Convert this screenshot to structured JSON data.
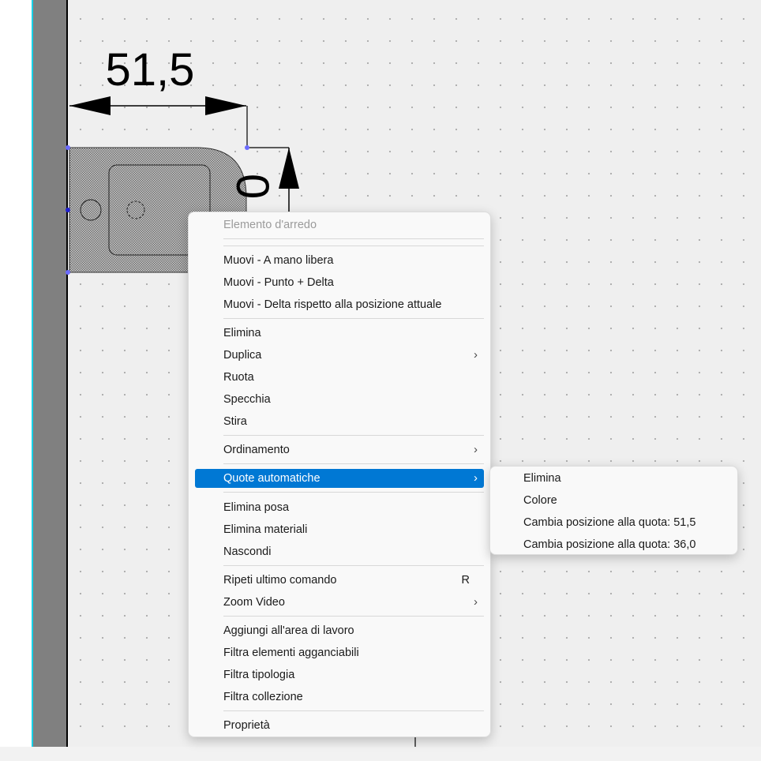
{
  "drawing": {
    "dimension_horizontal": "51,5",
    "dimension_vertical": "0"
  },
  "context_menu": {
    "header": "Elemento d'arredo",
    "items": [
      "Muovi - A mano libera",
      "Muovi - Punto + Delta",
      "Muovi - Delta rispetto alla posizione attuale",
      "Elimina",
      "Duplica",
      "Ruota",
      "Specchia",
      "Stira",
      "Ordinamento",
      "Quote automatiche",
      "Elimina posa",
      "Elimina materiali",
      "Nascondi",
      "Ripeti ultimo comando",
      "Zoom Video",
      "Aggiungi all'area di lavoro",
      "Filtra elementi agganciabili",
      "Filtra tipologia",
      "Filtra collezione",
      "Proprietà"
    ],
    "repeat_shortcut": "R",
    "chevron": "›"
  },
  "submenu": {
    "items": [
      "Elimina",
      "Colore",
      "Cambia posizione alla quota: 51,5",
      "Cambia posizione alla quota: 36,0"
    ]
  },
  "colors": {
    "highlight": "#0078d4",
    "wall": "#808080",
    "wall_edge": "#18d0e8",
    "handle": "#6b6bff"
  }
}
